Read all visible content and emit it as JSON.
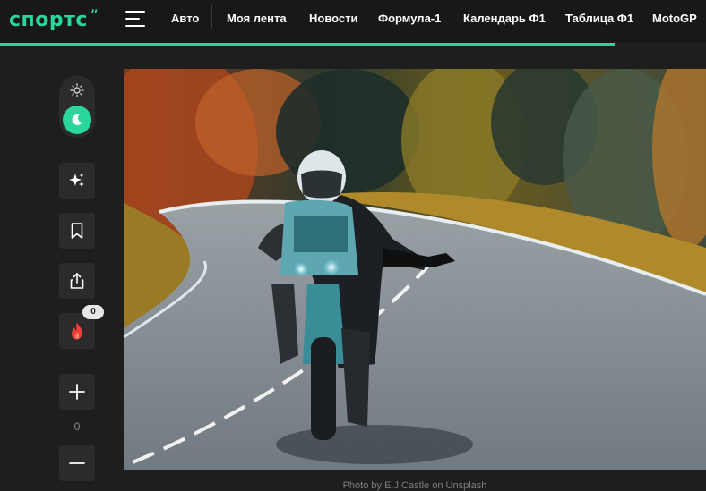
{
  "header": {
    "logo_text": "спортс",
    "logo_mark": "\"",
    "nav": [
      {
        "label": "Авто"
      },
      {
        "label": "Моя лента"
      },
      {
        "label": "Новости"
      },
      {
        "label": "Формула-1"
      },
      {
        "label": "Календарь Ф1"
      },
      {
        "label": "Таблица Ф1"
      },
      {
        "label": "MotoGP"
      }
    ]
  },
  "sidebar": {
    "badge_count": "0",
    "rating_count": "0"
  },
  "article": {
    "photo_caption": "Photo by E.J.Castle on Unsplash"
  },
  "colors": {
    "accent": "#2bd69d",
    "background": "#1e1e1e",
    "header_bg": "#181818",
    "button_bg": "#2b2b2b",
    "fire": "#ff3a3a"
  }
}
